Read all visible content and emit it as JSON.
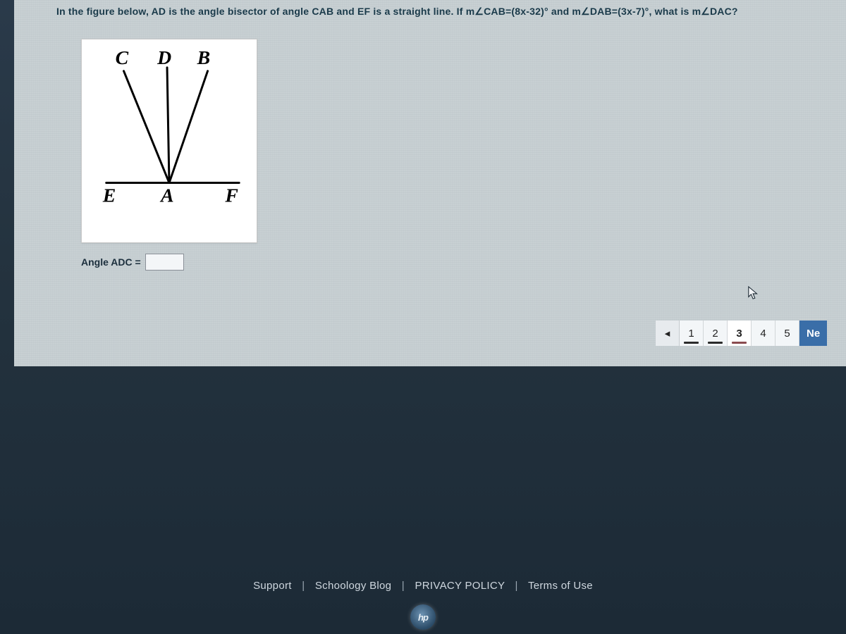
{
  "question": {
    "text": "In the figure below, AD is the angle bisector of angle CAB and EF is a straight line. If m∠CAB=(8x-32)° and m∠DAB=(3x-7)°, what is m∠DAC?"
  },
  "figure": {
    "labels": {
      "C": "C",
      "D": "D",
      "B": "B",
      "E": "E",
      "A": "A",
      "F": "F"
    }
  },
  "answer": {
    "label": "Angle ADC =",
    "value": ""
  },
  "pagination": {
    "prev_glyph": "◂",
    "pages": [
      "1",
      "2",
      "3",
      "4",
      "5"
    ],
    "current_index": 2,
    "next_label": "Ne"
  },
  "footer": {
    "links": [
      "Support",
      "Schoology Blog",
      "PRIVACY POLICY",
      "Terms of Use"
    ],
    "separator": "|"
  },
  "logo": {
    "text": "hp"
  },
  "cursor_icon_name": "cursor-icon"
}
